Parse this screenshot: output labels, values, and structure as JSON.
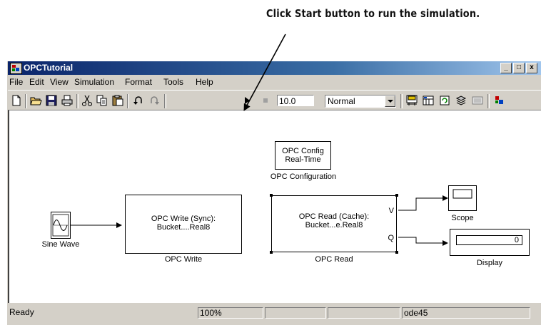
{
  "callout": {
    "text": "Click Start button to run the simulation."
  },
  "window": {
    "title": "OPCTutorial",
    "controls": {
      "minimize": "_",
      "maximize": "□",
      "close": "x"
    }
  },
  "menu": [
    "File",
    "Edit",
    "View",
    "Simulation",
    "Format",
    "Tools",
    "Help"
  ],
  "toolbar": {
    "stop_time": "10.0",
    "sim_mode": "Normal",
    "icons": [
      "new-icon",
      "open-icon",
      "save-icon",
      "print-icon",
      "cut-icon",
      "copy-icon",
      "paste-icon",
      "undo-icon",
      "redo-icon",
      "start-icon",
      "stop-icon",
      "library-browser-icon",
      "model-explorer-icon",
      "update-diagram-icon",
      "build-icon",
      "debug-icon",
      "toggle-icon"
    ]
  },
  "blocks": {
    "opc_config": {
      "line1": "OPC Config",
      "line2": "Real-Time",
      "name": "OPC Configuration"
    },
    "sine_wave": {
      "name": "Sine Wave"
    },
    "opc_write": {
      "line1": "OPC Write (Sync):",
      "line2": "Bucket....Real8",
      "name": "OPC Write"
    },
    "opc_read": {
      "line1": "OPC Read (Cache):",
      "line2": "Bucket...e.Real8",
      "name": "OPC Read",
      "port_v": "V",
      "port_q": "Q"
    },
    "scope": {
      "name": "Scope"
    },
    "display": {
      "name": "Display",
      "value": "0"
    }
  },
  "status": {
    "message": "Ready",
    "zoom": "100%",
    "cell3": "",
    "cell4": "",
    "cell5": "",
    "solver": "ode45"
  },
  "colors": {
    "titlebar_start": "#0a246a",
    "titlebar_end": "#a6caf0",
    "face": "#d4d0c8"
  }
}
